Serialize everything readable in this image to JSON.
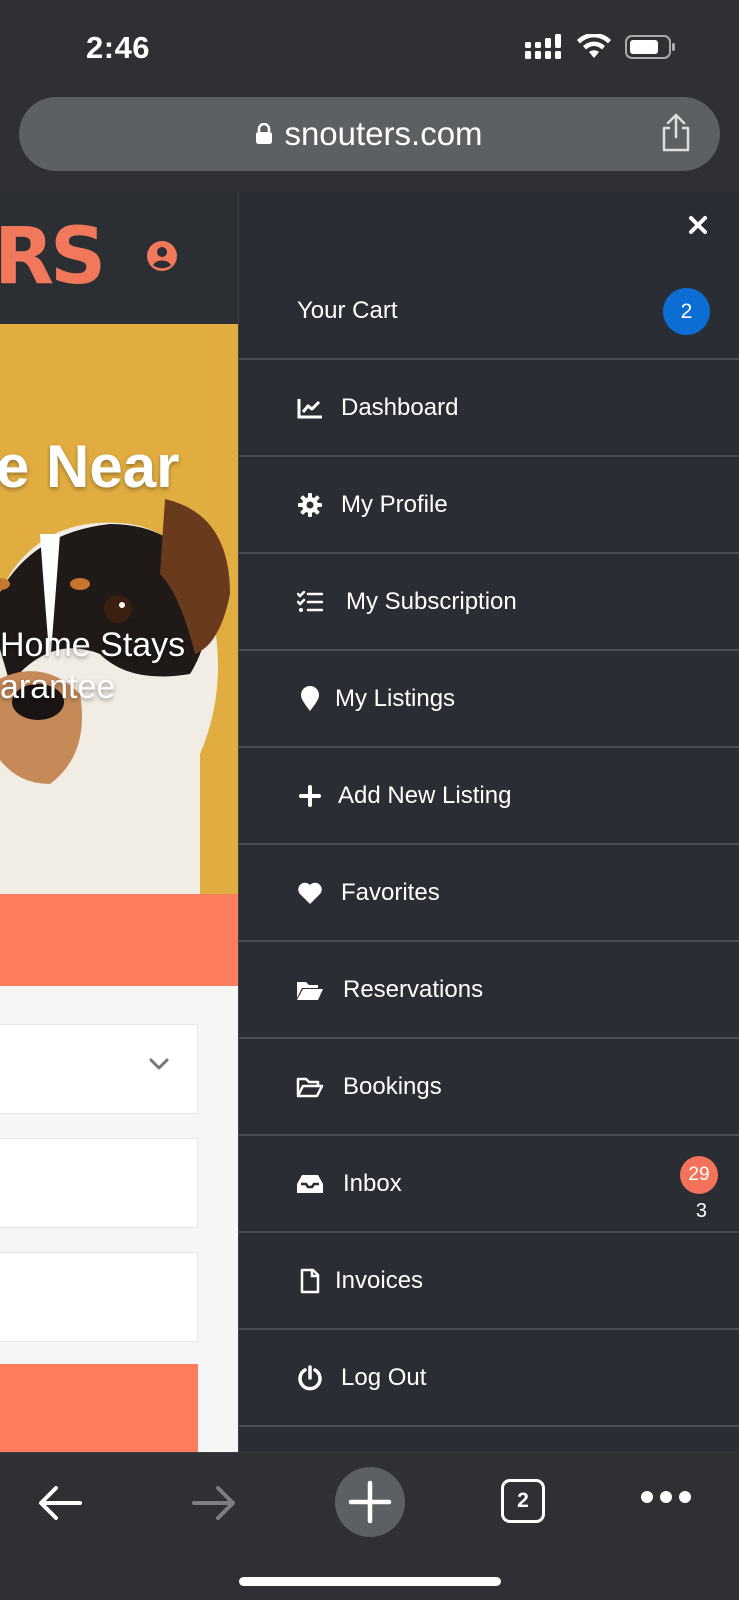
{
  "status": {
    "time": "2:46"
  },
  "browser": {
    "url": "snouters.com",
    "tab_count": "2"
  },
  "site": {
    "logo_fragment": "RS",
    "hero_title": "e Near",
    "hero_subtitle_line1": "Home Stays",
    "hero_subtitle_line2": "arantee"
  },
  "menu": {
    "cart_label": "Your Cart",
    "cart_badge": "2",
    "items": [
      {
        "label": "Dashboard",
        "icon": "chart-line-icon"
      },
      {
        "label": "My Profile",
        "icon": "gear-icon"
      },
      {
        "label": "My Subscription",
        "icon": "list-check-icon"
      },
      {
        "label": "My Listings",
        "icon": "map-pin-icon"
      },
      {
        "label": "Add New Listing",
        "icon": "plus-icon"
      },
      {
        "label": "Favorites",
        "icon": "heart-icon"
      },
      {
        "label": "Reservations",
        "icon": "folder-open-icon"
      },
      {
        "label": "Bookings",
        "icon": "folder-open-outline-icon"
      },
      {
        "label": "Inbox",
        "icon": "inbox-icon"
      },
      {
        "label": "Invoices",
        "icon": "file-icon"
      },
      {
        "label": "Log Out",
        "icon": "power-icon"
      }
    ],
    "inbox_badge": "29",
    "inbox_count": "3"
  },
  "colors": {
    "accent_coral": "#fe7d5c",
    "cart_badge_blue": "#0c6ed5",
    "drawer_bg": "#2a2d33",
    "hero_yellow": "#e2ad40"
  }
}
